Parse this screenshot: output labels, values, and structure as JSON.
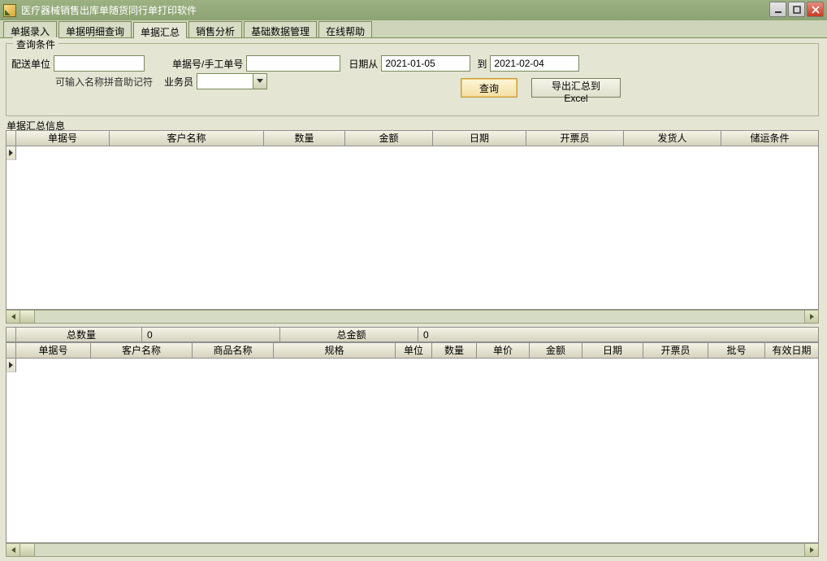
{
  "app": {
    "title": "医疗器械销售出库单随货同行单打印软件"
  },
  "tabs": [
    {
      "label": "单据录入"
    },
    {
      "label": "单据明细查询"
    },
    {
      "label": "单据汇总",
      "active": true
    },
    {
      "label": "销售分析"
    },
    {
      "label": "基础数据管理"
    },
    {
      "label": "在线帮助"
    }
  ],
  "query": {
    "legend": "查询条件",
    "deliver_unit_label": "配送单位",
    "deliver_unit_value": "",
    "deliver_unit_hint": "可输入名称拼音助记符",
    "docno_label": "单据号/手工单号",
    "docno_value": "",
    "date_from_label": "日期从",
    "date_from_value": "2021-01-05",
    "date_to_label": "到",
    "date_to_value": "2021-02-04",
    "salesman_label": "业务员",
    "salesman_value": "",
    "query_btn": "查询",
    "export_btn": "导出汇总到Excel"
  },
  "summary_section_label": "单据汇总信息",
  "summary_columns": [
    "单据号",
    "客户名称",
    "数量",
    "金额",
    "日期",
    "开票员",
    "发货人",
    "储运条件"
  ],
  "totals": {
    "qty_label": "总数量",
    "qty_value": "0",
    "amount_label": "总金额",
    "amount_value": "0"
  },
  "detail_columns": [
    "单据号",
    "客户名称",
    "商品名称",
    "规格",
    "单位",
    "数量",
    "单价",
    "金额",
    "日期",
    "开票员",
    "批号",
    "有效日期"
  ]
}
